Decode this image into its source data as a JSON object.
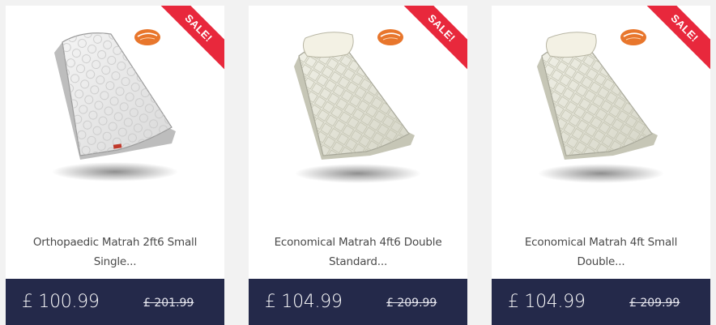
{
  "products": [
    {
      "image_alt": "Orthopaedic mattress",
      "ribbon": "SALE!",
      "brand_badge": "Sareer",
      "title_line1": "Orthopaedic Matrah 2ft6 Small",
      "title_line2": "Single...",
      "price": "£ 100.99",
      "old_price": "£ 201.99"
    },
    {
      "image_alt": "Economical mattress with pillow",
      "ribbon": "SALE!",
      "brand_badge": "Sareer",
      "title_line1": "Economical Matrah 4ft6 Double",
      "title_line2": "Standard...",
      "price": "£ 104.99",
      "old_price": "£ 209.99"
    },
    {
      "image_alt": "Economical mattress with pillow",
      "ribbon": "SALE!",
      "brand_badge": "Sareer",
      "title_line1": "Economical Matrah 4ft Small",
      "title_line2": "Double...",
      "price": "£ 104.99",
      "old_price": "£ 209.99"
    }
  ],
  "colors": {
    "ribbon": "#e8283c",
    "price_bar": "#24294a",
    "badge": "#e8762c"
  }
}
